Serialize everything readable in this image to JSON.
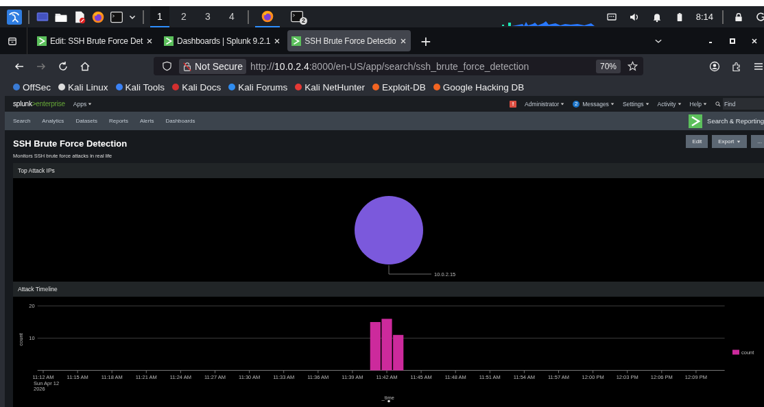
{
  "taskbar": {
    "workspaces": [
      {
        "label": "1",
        "selected": true
      },
      {
        "label": "2",
        "selected": false
      },
      {
        "label": "3",
        "selected": false
      },
      {
        "label": "4",
        "selected": false
      }
    ],
    "terminal_badge": "2",
    "clock": "8:14"
  },
  "browser": {
    "tabs": [
      {
        "title": "Edit: SSH Brute Force Det",
        "selected": false
      },
      {
        "title": "Dashboards | Splunk 9.2.1",
        "selected": false
      },
      {
        "title": "SSH Brute Force Detectio",
        "selected": true
      }
    ],
    "new_tab": "+",
    "nav": {
      "back_disabled": false,
      "forward_disabled": true
    },
    "security_label": "Not Secure",
    "url": {
      "scheme": "http://",
      "host": "10.0.2.4",
      "rest": ":8000/en-US/app/search/ssh_brute_force_detection"
    },
    "zoom": "70%",
    "bookmarks": [
      {
        "label": "OffSec",
        "color": "#3a7bd5"
      },
      {
        "label": "Kali Linux",
        "color": "#dddddd"
      },
      {
        "label": "Kali Tools",
        "color": "#3b82f6"
      },
      {
        "label": "Kali Docs",
        "color": "#d32f2f"
      },
      {
        "label": "Kali Forums",
        "color": "#2f8cf0"
      },
      {
        "label": "Kali NetHunter",
        "color": "#e53935"
      },
      {
        "label": "Exploit-DB",
        "color": "#f26522"
      },
      {
        "label": "Google Hacking DB",
        "color": "#f26522"
      }
    ]
  },
  "splunk": {
    "logo": {
      "brand": "splunk",
      "product": ">enterprise"
    },
    "apps_menu": "Apps",
    "alert_badge": "!",
    "menus": [
      {
        "label": "Administrator"
      },
      {
        "label": "Messages",
        "badge": "2"
      },
      {
        "label": "Settings"
      },
      {
        "label": "Activity"
      },
      {
        "label": "Help"
      }
    ],
    "find": {
      "placeholder": "Find"
    },
    "app_nav": [
      "Search",
      "Analytics",
      "Datasets",
      "Reports",
      "Alerts",
      "Dashboards"
    ],
    "app_name": "Search & Reporting"
  },
  "dashboard": {
    "title": "SSH Brute Force Detection",
    "description": "Monitors SSH brute force attacks in real life",
    "buttons": [
      {
        "label": "Edit",
        "dropdown": false
      },
      {
        "label": "Export",
        "dropdown": true
      },
      {
        "label": "...",
        "dropdown": false
      }
    ],
    "panels": [
      {
        "title": "Top Attack IPs",
        "chart_data": {
          "type": "pie",
          "categories": [
            "10.0.2.15"
          ],
          "series": [
            {
              "color": "#7b59dc",
              "values": [
                1
              ]
            }
          ]
        }
      },
      {
        "title": "Attack Timeline",
        "first_tick_date": [
          "Sun Apr 12",
          "2026"
        ],
        "chart_data": {
          "type": "bar",
          "xlabel": "_time",
          "ylabel": "count",
          "categories": [
            "11:12 AM",
            null,
            null,
            "11:15 AM",
            null,
            null,
            "11:18 AM",
            null,
            null,
            "11:21 AM",
            null,
            null,
            "11:24 AM",
            null,
            null,
            "11:27 AM",
            null,
            null,
            "11:30 AM",
            null,
            null,
            "11:33 AM",
            null,
            null,
            "11:36 AM",
            null,
            null,
            "11:39 AM",
            null,
            null,
            "11:42 AM",
            null,
            null,
            "11:45 AM",
            null,
            null,
            "11:48 AM",
            null,
            null,
            "11:51 AM",
            null,
            null,
            "11:54 AM",
            null,
            null,
            "11:57 AM",
            null,
            null,
            "12:00 PM",
            null,
            null,
            "12:03 PM",
            null,
            null,
            "12:06 PM",
            null,
            null,
            "12:09 PM",
            null,
            null
          ],
          "series": [
            {
              "name": "count",
              "color": "#cc2a9c",
              "values": [
                null,
                null,
                null,
                null,
                null,
                null,
                null,
                null,
                null,
                null,
                null,
                null,
                null,
                null,
                null,
                null,
                null,
                null,
                null,
                null,
                null,
                null,
                null,
                null,
                null,
                null,
                null,
                null,
                null,
                15,
                16,
                11,
                null,
                null,
                null,
                null,
                null,
                null,
                null,
                null,
                null,
                null,
                null,
                null,
                null,
                null,
                null,
                null,
                null,
                null,
                null,
                null,
                null,
                null,
                null,
                null,
                null,
                null,
                null,
                null
              ]
            }
          ],
          "ylim": [
            0,
            20
          ],
          "yticks": [
            10,
            20
          ]
        }
      }
    ]
  }
}
